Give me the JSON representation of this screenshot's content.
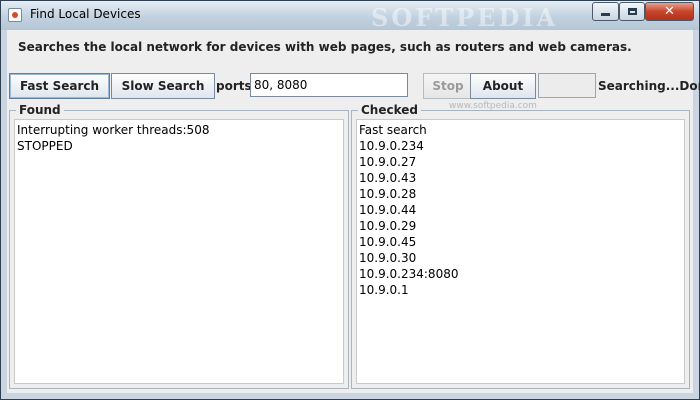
{
  "window": {
    "title": "Find Local Devices",
    "watermark": "SOFTPEDIA"
  },
  "description": "Searches the local network for devices with web pages, such as routers and web cameras.",
  "toolbar": {
    "fast_label": "Fast Search",
    "slow_label": "Slow Search",
    "ports_label": "ports:",
    "ports_value": "80, 8080",
    "stop_label": "Stop",
    "about_label": "About",
    "status": "Searching...Done",
    "site_watermark": "www.softpedia.com"
  },
  "found": {
    "legend": "Found",
    "lines": [
      "Interrupting worker threads:508",
      "STOPPED"
    ]
  },
  "checked": {
    "legend": "Checked",
    "lines": [
      "Fast search",
      "10.9.0.234",
      "10.9.0.27",
      "10.9.0.43",
      "10.9.0.28",
      "10.9.0.44",
      "10.9.0.29",
      "10.9.0.45",
      "10.9.0.30",
      "10.9.0.234:8080",
      "10.9.0.1"
    ]
  },
  "icons": {
    "app": "java-cup-icon",
    "minimize": "minimize-icon",
    "maximize": "maximize-icon",
    "close": "close-icon"
  },
  "colors": {
    "close_button": "#c7452a",
    "frame": "#c9d6e2"
  }
}
